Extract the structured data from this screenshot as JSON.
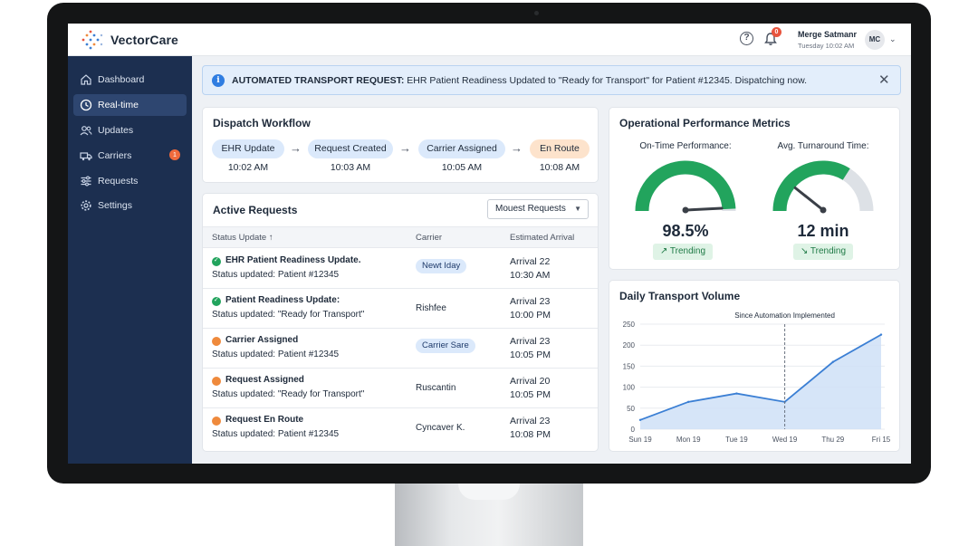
{
  "app": {
    "name": "VectorCare"
  },
  "topbar": {
    "user_name": "Merge Satmanr",
    "user_time": "Tuesday 10:02 AM",
    "user_initials": "MC",
    "notification_count": "0"
  },
  "sidebar": {
    "items": [
      {
        "label": "Dashboard",
        "icon": "home-icon",
        "active": false
      },
      {
        "label": "Real-time",
        "icon": "clock-icon",
        "active": true
      },
      {
        "label": "Updates",
        "icon": "users-icon",
        "active": false
      },
      {
        "label": "Carriers",
        "icon": "truck-icon",
        "active": false,
        "badge": "1"
      },
      {
        "label": "Requests",
        "icon": "sliders-icon",
        "active": false
      },
      {
        "label": "Settings",
        "icon": "gear-icon",
        "active": false
      }
    ]
  },
  "alert": {
    "prefix": "AUTOMATED TRANSPORT REQUEST:",
    "message": " EHR Patient Readiness Updated to \"Ready for Transport\" for Patient #12345. Dispatching now."
  },
  "workflow": {
    "title": "Dispatch Workflow",
    "steps": [
      {
        "label": "EHR Update",
        "time": "10:02 AM",
        "color": "#dbe9fb"
      },
      {
        "label": "Request Created",
        "time": "10:03 AM",
        "color": "#dbe9fb"
      },
      {
        "label": "Carrier Assigned",
        "time": "10:05 AM",
        "color": "#dbe9fb"
      },
      {
        "label": "En Route",
        "time": "10:08 AM",
        "color": "#fde3cc"
      }
    ]
  },
  "requests": {
    "title": "Active Requests",
    "dropdown_label": "Mouest Requests",
    "columns": [
      "Status Update",
      "Carrier",
      "Estimated Arrival"
    ],
    "rows": [
      {
        "status": "green",
        "title": "EHR Patient Readiness Update.",
        "sub": "Status updated: Patient #12345",
        "carrier": "Newt Iday",
        "chip": true,
        "arrival_day": "Arrival 22",
        "arrival_time": "10:30 AM"
      },
      {
        "status": "green",
        "title": "Patient Readiness Update:",
        "sub": "Status updated: \"Ready for Transport\"",
        "carrier": "Rishfee",
        "chip": false,
        "arrival_day": "Arrival 23",
        "arrival_time": "10:00 PM"
      },
      {
        "status": "orange",
        "title": "Carrier Assigned",
        "sub": "Status updated: Patient #12345",
        "carrier": "Carrier Sare",
        "chip": true,
        "arrival_day": "Arrival 23",
        "arrival_time": "10:05 PM"
      },
      {
        "status": "orange",
        "title": "Request Assigned",
        "sub": "Status updated: \"Ready for Transport\"",
        "carrier": "Ruscantin",
        "chip": false,
        "arrival_day": "Arrival 20",
        "arrival_time": "10:05 PM"
      },
      {
        "status": "orange",
        "title": "Request En Route",
        "sub": "Status updated: Patient #12345",
        "carrier": "Cyncaver K.",
        "chip": false,
        "arrival_day": "Arrival 23",
        "arrival_time": "10:08 PM"
      }
    ]
  },
  "metrics": {
    "title": "Operational Performance Metrics",
    "items": [
      {
        "label": "On-Time Performance:",
        "value": "98.5%",
        "fraction": 0.985,
        "trend": "↗ Trending"
      },
      {
        "label": "Avg. Turnaround Time:",
        "value": "12 min",
        "fraction": 0.68,
        "trend": "↘ Trending"
      }
    ]
  },
  "chart_data": {
    "type": "area",
    "title": "Daily Transport Volume",
    "categories": [
      "Sun 19",
      "Mon 19",
      "Tue 19",
      "Wed 19",
      "Thu 29",
      "Fri 15"
    ],
    "series": [
      {
        "values": [
          22,
          65,
          85,
          65,
          160,
          225
        ]
      }
    ],
    "ylim": [
      0,
      250
    ],
    "yticks": [
      0,
      50,
      100,
      150,
      200,
      250
    ],
    "annotation": {
      "text": "Since Automation Implemented",
      "at_category": "Wed 19"
    },
    "colors": {
      "line": "#3b7fd4",
      "fill": "#cfe0f7"
    }
  }
}
